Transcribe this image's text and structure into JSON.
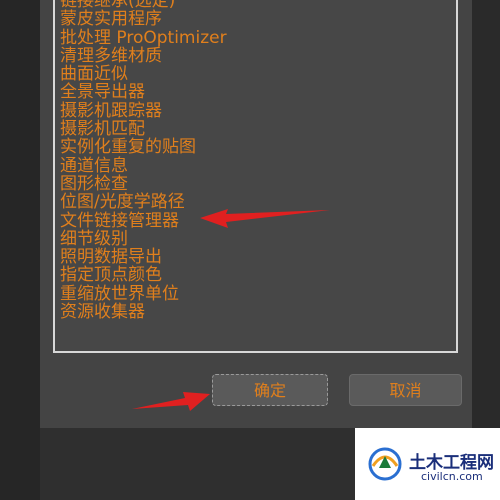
{
  "list": {
    "items": [
      "链接继承(选定)",
      "蒙皮实用程序",
      "批处理 ProOptimizer",
      "清理多维材质",
      "曲面近似",
      "全景导出器",
      "摄影机跟踪器",
      "摄影机匹配",
      "实例化重复的贴图",
      "通道信息",
      "图形检查",
      "位图/光度学路径",
      "文件链接管理器",
      "细节级别",
      "照明数据导出",
      "指定顶点颜色",
      "重缩放世界单位",
      "资源收集器"
    ]
  },
  "buttons": {
    "ok_label": "确定",
    "cancel_label": "取消"
  },
  "watermark": {
    "title": "土木工程网",
    "subtitle": "civilcn.com"
  },
  "colors": {
    "item_text": "#e07f1c",
    "arrow": "#e02020",
    "watermark_text": "#1a2e7a"
  }
}
